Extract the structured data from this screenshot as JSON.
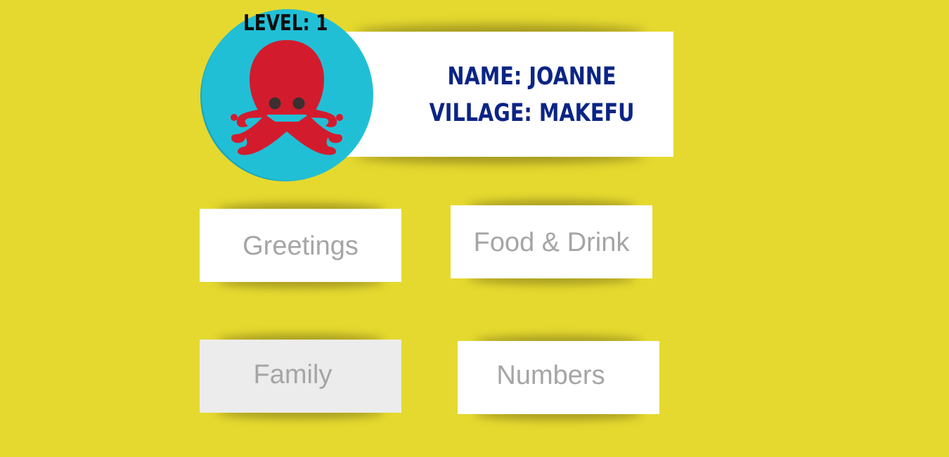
{
  "profile": {
    "level_label": "LEVEL: 1",
    "name_line": "NAME: JOANNE",
    "village_line": "VILLAGE: MAKEFU",
    "avatar_icon": "octopus-icon"
  },
  "categories": [
    {
      "label": "Greetings"
    },
    {
      "label": "Food & Drink"
    },
    {
      "label": "Family"
    },
    {
      "label": "Numbers"
    }
  ],
  "colors": {
    "background": "#e5d92f",
    "avatar_circle": "#21bfd6",
    "octopus": "#d21c2e",
    "profile_text": "#0b2585",
    "button_text": "#a5a5a5"
  }
}
